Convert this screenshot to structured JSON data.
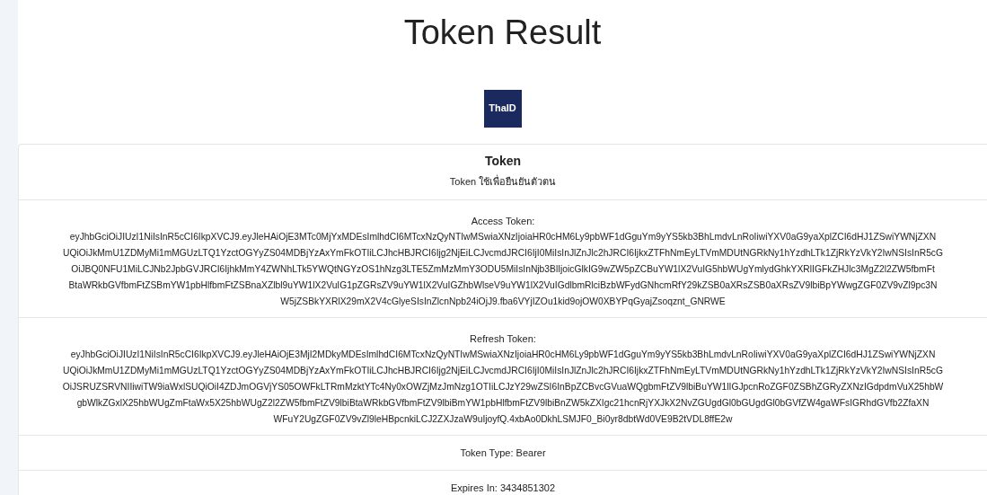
{
  "page_title": "Token Result",
  "logo": {
    "text": "ThaID"
  },
  "card": {
    "heading": "Token",
    "subtitle": "Token ใช้เพื่อยืนยันตัวตน"
  },
  "items": [
    {
      "kind": "token",
      "label": "Access Token:",
      "lines": [
        "eyJhbGciOiJIUzI1NiIsInR5cCI6IkpXVCJ9.eyJleHAiOjE3MTc0MjYxMDEsImlhdCI6MTcxNzQyNTIwMSwiaXNzIjoiaHR0cHM6Ly9pbWF1dGguYm9yYS5kb3BhLmdvLnRoIiwiYXV0aG9yaXplZCI6dHJ1ZSwiYWNjZXN",
        "UQiOiJkMmU1ZDMyMi1mMGUzLTQ1YzctOGYyZS04MDBjYzAxYmFkOTIiLCJhcHBJRCI6Ijg2NjEiLCJvcmdJRCI6IjI0MiIsInJlZnJlc2hJRCI6IjkxZTFhNmEyLTVmMDUtNGRkNy1hYzdhLTk1ZjRkYzVkY2IwNSIsInR5cG",
        "OiJBQ0NFU1MiLCJNb2JpbGVJRCI6IjhkMmY4ZWNhLTk5YWQtNGYzOS1hNzg3LTE5ZmMzMmY3ODU5MiIsInNjb3BlIjoicGlkIG9wZW5pZCBuYW1lX2VuIG5hbWUgYmlydGhkYXRlIGFkZHJlc3MgZ2l2ZW5fbmFt",
        "BtaWRkbGVfbmFtZSBmYW1pbHlfbmFtZSBnaXZlbl9uYW1lX2VuIG1pZGRsZV9uYW1lX2VuIGZhbWlseV9uYW1lX2VuIGdlbmRlciBzbWFydGNhcmRfY29kZSB0aXRsZSB0aXRsZV9lbiBpYWwgZGF0ZV9vZl9pc3N",
        "W5jZSBkYXRlX29mX2V4cGlyeSIsInZlcnNpb24iOjJ9.fba6VYjIZOu1kid9ojOW0XBYPqGyajZsoqznt_GNRWE"
      ]
    },
    {
      "kind": "token",
      "label": "Refresh Token:",
      "lines": [
        "eyJhbGciOiJIUzI1NiIsInR5cCI6IkpXVCJ9.eyJleHAiOjE3MjI2MDkyMDEsImlhdCI6MTcxNzQyNTIwMSwiaXNzIjoiaHR0cHM6Ly9pbWF1dGguYm9yYS5kb3BhLmdvLnRoIiwiYXV0aG9yaXplZCI6dHJ1ZSwiYWNjZXN",
        "UQiOiJkMmU1ZDMyMi1mMGUzLTQ1YzctOGYyZS04MDBjYzAxYmFkOTIiLCJhcHBJRCI6Ijg2NjEiLCJvcmdJRCI6IjI0MiIsInJlZnJlc2hJRCI6IjkxZTFhNmEyLTVmMDUtNGRkNy1hYzdhLTk1ZjRkYzVkY2IwNSIsInR5cG",
        "OiJSRUZSRVNIIiwiTW9iaWxlSUQiOiI4ZDJmOGVjYS05OWFkLTRmMzktYTc4Ny0xOWZjMzJmNzg1OTIiLCJzY29wZSI6InBpZCBvcGVuaWQgbmFtZV9lbiBuYW1lIGJpcnRoZGF0ZSBhZGRyZXNzIGdpdmVuX25hbW",
        "gbWlkZGxlX25hbWUgZmFtaWx5X25hbWUgZ2l2ZW5fbmFtZV9lbiBtaWRkbGVfbmFtZV9lbiBmYW1pbHlfbmFtZV9lbiBnZW5kZXIgc21hcnRjYXJkX2NvZGUgdGl0bGUgdGl0bGVfZW4gaWFsIGRhdGVfb2ZfaXN",
        "WFuY2UgZGF0ZV9vZl9leHBpcnkiLCJ2ZXJzaW9uIjoyfQ.4xbAo0DkhLSMJF0_Bi0yr8dbtWd0VE9B2tVDL8ffE2w"
      ]
    },
    {
      "kind": "plain",
      "text": "Token Type: Bearer"
    },
    {
      "kind": "plain",
      "text": "Expires In: 3434851302"
    }
  ]
}
